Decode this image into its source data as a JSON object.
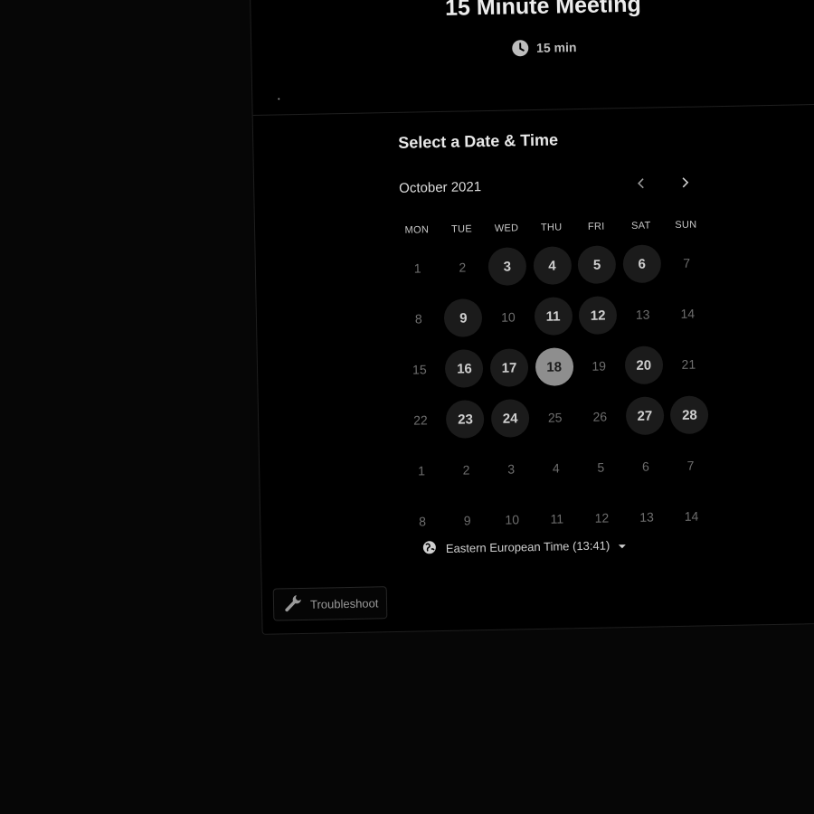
{
  "event": {
    "title": "15 Minute Meeting",
    "duration": "15 min"
  },
  "scheduler": {
    "section_title": "Select a Date & Time",
    "month_label": "October 2021",
    "weekdays": [
      "MON",
      "TUE",
      "WED",
      "THU",
      "FRI",
      "SAT",
      "SUN"
    ],
    "weeks": [
      [
        {
          "d": "1",
          "s": "off"
        },
        {
          "d": "2",
          "s": "off"
        },
        {
          "d": "3",
          "s": "available"
        },
        {
          "d": "4",
          "s": "available"
        },
        {
          "d": "5",
          "s": "available"
        },
        {
          "d": "6",
          "s": "available"
        },
        {
          "d": "7",
          "s": "off"
        }
      ],
      [
        {
          "d": "8",
          "s": "off"
        },
        {
          "d": "9",
          "s": "available"
        },
        {
          "d": "10",
          "s": "off"
        },
        {
          "d": "11",
          "s": "available"
        },
        {
          "d": "12",
          "s": "available"
        },
        {
          "d": "13",
          "s": "off"
        },
        {
          "d": "14",
          "s": "off"
        }
      ],
      [
        {
          "d": "15",
          "s": "off"
        },
        {
          "d": "16",
          "s": "available"
        },
        {
          "d": "17",
          "s": "available"
        },
        {
          "d": "18",
          "s": "selected"
        },
        {
          "d": "19",
          "s": "off"
        },
        {
          "d": "20",
          "s": "available"
        },
        {
          "d": "21",
          "s": "off"
        }
      ],
      [
        {
          "d": "22",
          "s": "off"
        },
        {
          "d": "23",
          "s": "available"
        },
        {
          "d": "24",
          "s": "available"
        },
        {
          "d": "25",
          "s": "off"
        },
        {
          "d": "26",
          "s": "off"
        },
        {
          "d": "27",
          "s": "available"
        },
        {
          "d": "28",
          "s": "available"
        }
      ],
      [
        {
          "d": "1",
          "s": "off"
        },
        {
          "d": "2",
          "s": "off"
        },
        {
          "d": "3",
          "s": "off"
        },
        {
          "d": "4",
          "s": "off"
        },
        {
          "d": "5",
          "s": "off"
        },
        {
          "d": "6",
          "s": "off"
        },
        {
          "d": "7",
          "s": "off"
        }
      ],
      [
        {
          "d": "8",
          "s": "off"
        },
        {
          "d": "9",
          "s": "off"
        },
        {
          "d": "10",
          "s": "off"
        },
        {
          "d": "11",
          "s": "off"
        },
        {
          "d": "12",
          "s": "off"
        },
        {
          "d": "13",
          "s": "off"
        },
        {
          "d": "14",
          "s": "off"
        }
      ]
    ],
    "timezone_label": "Eastern European Time (13:41)"
  },
  "troubleshoot": {
    "label": "Troubleshoot"
  },
  "icons": {
    "duration": "clock-icon",
    "prev": "chevron-left-icon",
    "next": "chevron-right-icon",
    "timezone": "globe-icon",
    "troubleshoot": "wrench-icon",
    "timezone_dropdown": "caret-down-icon"
  },
  "colors": {
    "background": "#000000",
    "available_day_bg": "#1b1b1b",
    "selected_day_bg": "#8e8e8e",
    "text_primary": "#ececec",
    "text_muted": "#6d6d6d"
  }
}
